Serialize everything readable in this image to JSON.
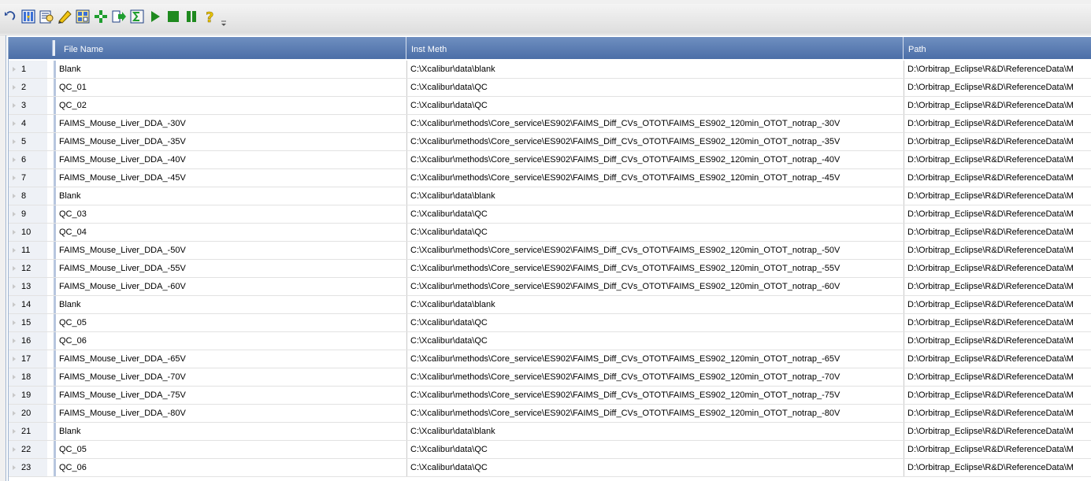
{
  "toolbar": {
    "icons": [
      "undo-icon",
      "columns-icon",
      "edit-sheet-icon",
      "pencil-icon",
      "calc-icon",
      "add-row-icon",
      "insert-after-icon",
      "sum-icon",
      "play-icon",
      "stop-icon",
      "pause-icon",
      "help-icon"
    ]
  },
  "columns": {
    "file_name": "File Name",
    "inst_meth": "Inst Meth",
    "path": "Path"
  },
  "rows": [
    {
      "num": "1",
      "file": "Blank",
      "meth": "C:\\Xcalibur\\data\\blank",
      "path": "D:\\Orbitrap_Eclipse\\R&D\\ReferenceData\\M"
    },
    {
      "num": "2",
      "file": "QC_01",
      "meth": "C:\\Xcalibur\\data\\QC",
      "path": "D:\\Orbitrap_Eclipse\\R&D\\ReferenceData\\M"
    },
    {
      "num": "3",
      "file": "QC_02",
      "meth": "C:\\Xcalibur\\data\\QC",
      "path": "D:\\Orbitrap_Eclipse\\R&D\\ReferenceData\\M"
    },
    {
      "num": "4",
      "file": "FAIMS_Mouse_Liver_DDA_-30V",
      "meth": "C:\\Xcalibur\\methods\\Core_service\\ES902\\FAIMS_Diff_CVs_OTOT\\FAIMS_ES902_120min_OTOT_notrap_-30V",
      "path": "D:\\Orbitrap_Eclipse\\R&D\\ReferenceData\\M"
    },
    {
      "num": "5",
      "file": "FAIMS_Mouse_Liver_DDA_-35V",
      "meth": "C:\\Xcalibur\\methods\\Core_service\\ES902\\FAIMS_Diff_CVs_OTOT\\FAIMS_ES902_120min_OTOT_notrap_-35V",
      "path": "D:\\Orbitrap_Eclipse\\R&D\\ReferenceData\\M"
    },
    {
      "num": "6",
      "file": "FAIMS_Mouse_Liver_DDA_-40V",
      "meth": "C:\\Xcalibur\\methods\\Core_service\\ES902\\FAIMS_Diff_CVs_OTOT\\FAIMS_ES902_120min_OTOT_notrap_-40V",
      "path": "D:\\Orbitrap_Eclipse\\R&D\\ReferenceData\\M"
    },
    {
      "num": "7",
      "file": "FAIMS_Mouse_Liver_DDA_-45V",
      "meth": "C:\\Xcalibur\\methods\\Core_service\\ES902\\FAIMS_Diff_CVs_OTOT\\FAIMS_ES902_120min_OTOT_notrap_-45V",
      "path": "D:\\Orbitrap_Eclipse\\R&D\\ReferenceData\\M"
    },
    {
      "num": "8",
      "file": "Blank",
      "meth": "C:\\Xcalibur\\data\\blank",
      "path": "D:\\Orbitrap_Eclipse\\R&D\\ReferenceData\\M"
    },
    {
      "num": "9",
      "file": "QC_03",
      "meth": "C:\\Xcalibur\\data\\QC",
      "path": "D:\\Orbitrap_Eclipse\\R&D\\ReferenceData\\M"
    },
    {
      "num": "10",
      "file": "QC_04",
      "meth": "C:\\Xcalibur\\data\\QC",
      "path": "D:\\Orbitrap_Eclipse\\R&D\\ReferenceData\\M"
    },
    {
      "num": "11",
      "file": "FAIMS_Mouse_Liver_DDA_-50V",
      "meth": "C:\\Xcalibur\\methods\\Core_service\\ES902\\FAIMS_Diff_CVs_OTOT\\FAIMS_ES902_120min_OTOT_notrap_-50V",
      "path": "D:\\Orbitrap_Eclipse\\R&D\\ReferenceData\\M"
    },
    {
      "num": "12",
      "file": "FAIMS_Mouse_Liver_DDA_-55V",
      "meth": "C:\\Xcalibur\\methods\\Core_service\\ES902\\FAIMS_Diff_CVs_OTOT\\FAIMS_ES902_120min_OTOT_notrap_-55V",
      "path": "D:\\Orbitrap_Eclipse\\R&D\\ReferenceData\\M"
    },
    {
      "num": "13",
      "file": "FAIMS_Mouse_Liver_DDA_-60V",
      "meth": "C:\\Xcalibur\\methods\\Core_service\\ES902\\FAIMS_Diff_CVs_OTOT\\FAIMS_ES902_120min_OTOT_notrap_-60V",
      "path": "D:\\Orbitrap_Eclipse\\R&D\\ReferenceData\\M"
    },
    {
      "num": "14",
      "file": "Blank",
      "meth": "C:\\Xcalibur\\data\\blank",
      "path": "D:\\Orbitrap_Eclipse\\R&D\\ReferenceData\\M"
    },
    {
      "num": "15",
      "file": "QC_05",
      "meth": "C:\\Xcalibur\\data\\QC",
      "path": "D:\\Orbitrap_Eclipse\\R&D\\ReferenceData\\M"
    },
    {
      "num": "16",
      "file": "QC_06",
      "meth": "C:\\Xcalibur\\data\\QC",
      "path": "D:\\Orbitrap_Eclipse\\R&D\\ReferenceData\\M"
    },
    {
      "num": "17",
      "file": "FAIMS_Mouse_Liver_DDA_-65V",
      "meth": "C:\\Xcalibur\\methods\\Core_service\\ES902\\FAIMS_Diff_CVs_OTOT\\FAIMS_ES902_120min_OTOT_notrap_-65V",
      "path": "D:\\Orbitrap_Eclipse\\R&D\\ReferenceData\\M"
    },
    {
      "num": "18",
      "file": "FAIMS_Mouse_Liver_DDA_-70V",
      "meth": "C:\\Xcalibur\\methods\\Core_service\\ES902\\FAIMS_Diff_CVs_OTOT\\FAIMS_ES902_120min_OTOT_notrap_-70V",
      "path": "D:\\Orbitrap_Eclipse\\R&D\\ReferenceData\\M"
    },
    {
      "num": "19",
      "file": "FAIMS_Mouse_Liver_DDA_-75V",
      "meth": "C:\\Xcalibur\\methods\\Core_service\\ES902\\FAIMS_Diff_CVs_OTOT\\FAIMS_ES902_120min_OTOT_notrap_-75V",
      "path": "D:\\Orbitrap_Eclipse\\R&D\\ReferenceData\\M"
    },
    {
      "num": "20",
      "file": "FAIMS_Mouse_Liver_DDA_-80V",
      "meth": "C:\\Xcalibur\\methods\\Core_service\\ES902\\FAIMS_Diff_CVs_OTOT\\FAIMS_ES902_120min_OTOT_notrap_-80V",
      "path": "D:\\Orbitrap_Eclipse\\R&D\\ReferenceData\\M"
    },
    {
      "num": "21",
      "file": "Blank",
      "meth": "C:\\Xcalibur\\data\\blank",
      "path": "D:\\Orbitrap_Eclipse\\R&D\\ReferenceData\\M"
    },
    {
      "num": "22",
      "file": "QC_05",
      "meth": "C:\\Xcalibur\\data\\QC",
      "path": "D:\\Orbitrap_Eclipse\\R&D\\ReferenceData\\M"
    },
    {
      "num": "23",
      "file": "QC_06",
      "meth": "C:\\Xcalibur\\data\\QC",
      "path": "D:\\Orbitrap_Eclipse\\R&D\\ReferenceData\\M"
    }
  ]
}
